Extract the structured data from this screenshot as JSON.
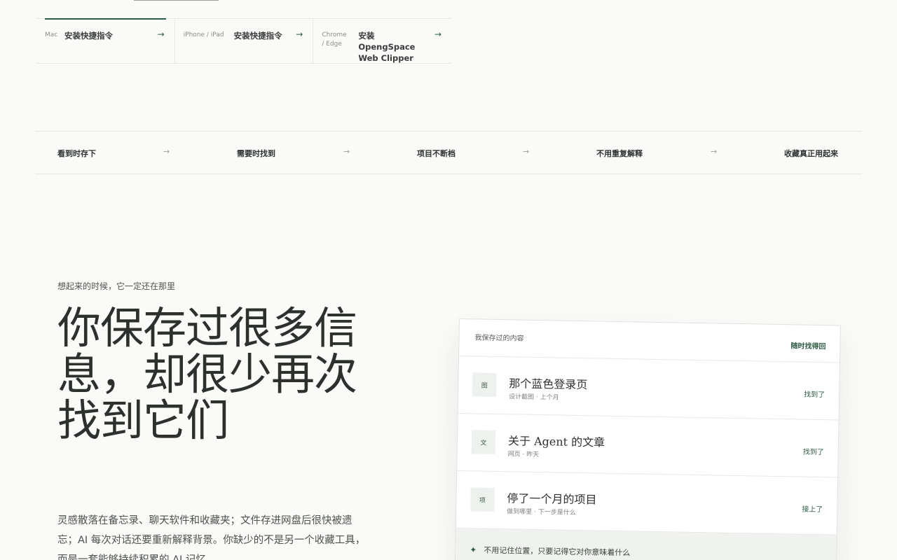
{
  "install": [
    {
      "platform": "Mac",
      "label": "安装快捷指令",
      "arrow": "→"
    },
    {
      "platform": "iPhone / iPad",
      "label": "安装快捷指令",
      "arrow": "→"
    },
    {
      "platform": "Chrome / Edge",
      "label": "安装 OpengSpace Web Clipper",
      "arrow": "→"
    }
  ],
  "steps": [
    "看到时存下",
    "需要时找到",
    "项目不断档",
    "不用重复解释",
    "收藏真正用起来"
  ],
  "step_arrow": "→",
  "hero": {
    "eyebrow": "想起来的时候，它一定还在那里",
    "title": "你保存过很多信息，却很少再次找到它们",
    "description": "灵感散落在备忘录、聊天软件和收藏夹；文件存进网盘后很快被遗忘；AI 每次对话还要重新解释背景。你缺少的不是另一个收藏工具，而是一套能够持续积累的 AI 记忆"
  },
  "card": {
    "header_label": "我保存过的内容",
    "header_action": "随时找得回",
    "items": [
      {
        "badge": "图",
        "title": "那个蓝色登录页",
        "meta": "设计截图 · 上个月",
        "status": "找到了"
      },
      {
        "badge": "文",
        "title": "关于 Agent 的文章",
        "meta": "网页 · 昨天",
        "status": "找到了"
      },
      {
        "badge": "项",
        "title": "停了一个月的项目",
        "meta": "做到哪里 · 下一步是什么",
        "status": "接上了"
      }
    ],
    "footer_icon": "✦",
    "footer_note": "不用记住位置，只要记得它对你意味着什么"
  },
  "colors": {
    "accent": "#2f5d43",
    "background": "#fafaf8"
  }
}
